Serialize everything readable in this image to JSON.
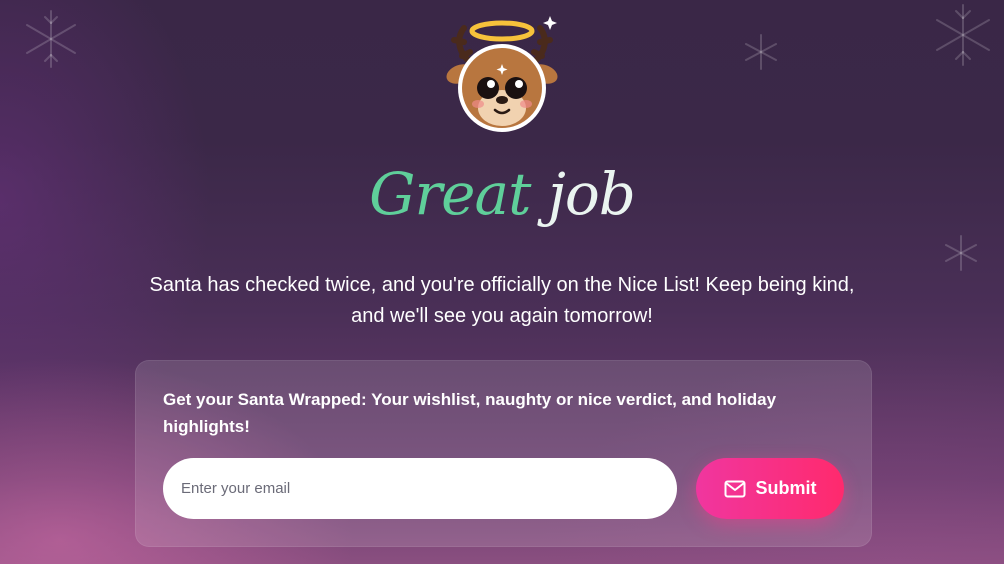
{
  "headline": {
    "word1": "Great",
    "word2": "job"
  },
  "subtitle": "Santa has checked twice, and you're officially on the Nice List! Keep being kind, and we'll see you again tomorrow!",
  "card": {
    "text": "Get your Santa Wrapped: Your wishlist, naughty or nice verdict, and holiday highlights!",
    "email_placeholder": "Enter your email",
    "submit_label": "Submit",
    "submit_icon": "mail-icon"
  },
  "mascot": {
    "icon": "angel-reindeer-icon"
  },
  "colors": {
    "accent_green": "#5fcf9a",
    "button_pink": "#f0369f",
    "button_red": "#ff2a6d"
  }
}
